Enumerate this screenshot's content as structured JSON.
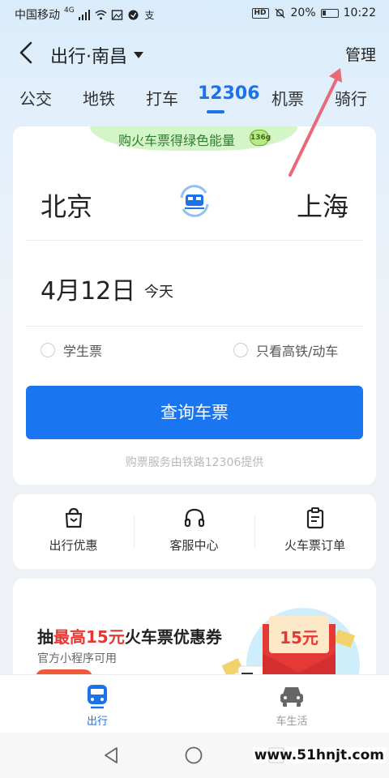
{
  "status_bar": {
    "carrier": "中国移动",
    "network": "4G",
    "battery": "20%",
    "time": "10:22",
    "hd_label": "HD"
  },
  "header": {
    "title": "出行·南昌",
    "manage": "管理"
  },
  "tabs": [
    {
      "label": "公交"
    },
    {
      "label": "地铁"
    },
    {
      "label": "打车"
    },
    {
      "label": "12306",
      "active": true
    },
    {
      "label": "机票"
    },
    {
      "label": "骑行"
    }
  ],
  "ticket": {
    "banner": "购火车票得绿色能量",
    "energy": "136g",
    "from": "北京",
    "to": "上海",
    "date": "4月12日",
    "day": "今天",
    "options": [
      {
        "label": "学生票",
        "checked": false
      },
      {
        "label": "只看高铁/动车",
        "checked": false
      }
    ],
    "query_button": "查询车票",
    "service_note": "购票服务由铁路12306提供"
  },
  "quick_actions": [
    {
      "label": "出行优惠",
      "icon": "gift-bag-icon"
    },
    {
      "label": "客服中心",
      "icon": "headset-icon"
    },
    {
      "label": "火车票订单",
      "icon": "clipboard-icon"
    }
  ],
  "promo": {
    "title_prefix": "抽",
    "title_highlight": "最高15元",
    "title_suffix": "火车票优惠券",
    "subtitle": "官方小程序可用",
    "coupon_amount": "15元"
  },
  "bottom_tabs": [
    {
      "label": "出行",
      "active": true,
      "icon": "train-icon"
    },
    {
      "label": "车生活",
      "active": false,
      "icon": "car-icon"
    }
  ],
  "watermark": "www.51hnjt.com",
  "colors": {
    "accent": "#1a73e8",
    "button": "#1a76f0",
    "promo_red": "#e53935",
    "annotation": "#e86a7a"
  }
}
